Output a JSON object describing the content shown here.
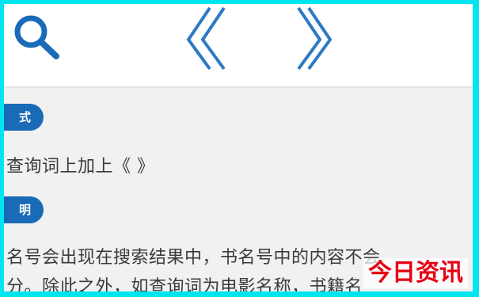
{
  "header": {
    "search_icon": "search-icon",
    "title_icon": "double-angle-brackets-icon"
  },
  "content": {
    "badge_1": "式",
    "line_1": "查询词上加上《 》",
    "badge_2": "明",
    "line_2": "名号会出现在搜索结果中，书名号中的内容不会",
    "line_3": "分。除此之外，如查询词为电影名称，书籍名"
  },
  "watermark": {
    "text": "今日资讯"
  },
  "colors": {
    "outer_border": "#00e5f0",
    "accent_blue": "#196bb8",
    "watermark_red": "#e60012"
  }
}
